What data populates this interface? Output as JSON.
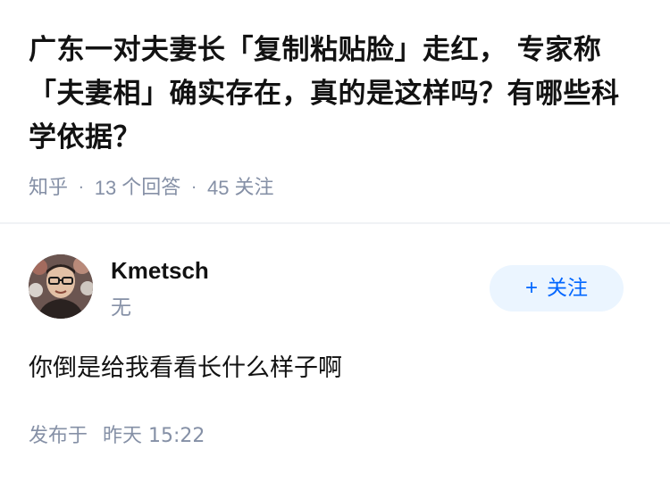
{
  "question": {
    "title": "广东一对夫妻长「复制粘贴脸」走红， 专家称「夫妻相」确实存在，真的是这样吗？有哪些科学依据？",
    "source": "知乎",
    "separator": "·",
    "answer_count": "13",
    "answer_label": "个回答",
    "follower_count": "45",
    "follower_label": "关注"
  },
  "answer": {
    "author": {
      "name": "Kmetsch",
      "headline": "无",
      "avatar_icon": "user-avatar-photo"
    },
    "follow_button": {
      "plus": "+",
      "label": "关注"
    },
    "content": "你倒是给我看看长什么样子啊",
    "time_prefix": "发布于",
    "time": "昨天 15:22"
  },
  "colors": {
    "title": "#121212",
    "meta": "#8590a6",
    "follow_bg": "#ebf5ff",
    "follow_text": "#0066ff",
    "divider": "#f0f2f5"
  }
}
